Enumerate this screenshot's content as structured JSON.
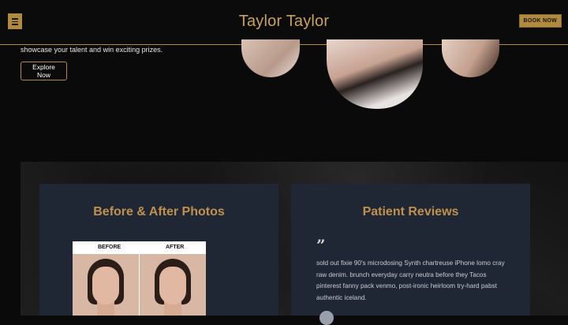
{
  "header": {
    "menu_icon": "hamburger-icon",
    "brand": "Taylor Taylor",
    "book_label": "BOOK NOW"
  },
  "hero": {
    "text": "showcase your talent and win exciting prizes.",
    "explore_label": "Explore Now"
  },
  "before_after": {
    "title": "Before & After Photos",
    "before_label": "BEFORE",
    "after_label": "AFTER"
  },
  "reviews": {
    "title": "Patient Reviews",
    "quote_icon": "quote-icon",
    "text": "sold out fixie 90's microdosing Synth chartreuse iPhone lomo cray raw denim. brunch everyday carry neutra before they Tacos pinterest fanny pack venmo, post-ironic heirloom try-hard pabst authentic iceland."
  },
  "colors": {
    "accent": "#b08a3e",
    "card_bg": "#1f2735",
    "page_bg": "#0a0a0a"
  }
}
